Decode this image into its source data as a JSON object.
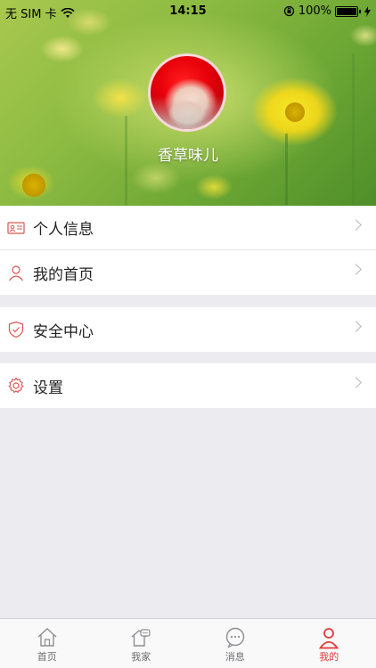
{
  "status_bar": {
    "carrier": "无 SIM 卡",
    "time": "14:15",
    "battery": "100%"
  },
  "profile": {
    "username": "香草味儿"
  },
  "menu": {
    "group1": [
      {
        "label": "个人信息",
        "icon": "id-card-icon"
      },
      {
        "label": "我的首页",
        "icon": "user-icon"
      }
    ],
    "group2": [
      {
        "label": "安全中心",
        "icon": "shield-icon"
      }
    ],
    "group3": [
      {
        "label": "设置",
        "icon": "gear-icon"
      }
    ]
  },
  "tab_bar": {
    "tabs": [
      {
        "label": "首页",
        "icon": "home-icon",
        "active": false
      },
      {
        "label": "我家",
        "icon": "house-chat-icon",
        "active": false
      },
      {
        "label": "消息",
        "icon": "message-icon",
        "active": false
      },
      {
        "label": "我的",
        "icon": "person-icon",
        "active": true
      }
    ]
  },
  "colors": {
    "accent": "#e23a3a",
    "icon_red": "#d9534f",
    "tab_inactive": "#8e8e93",
    "background": "#ebebf0"
  }
}
